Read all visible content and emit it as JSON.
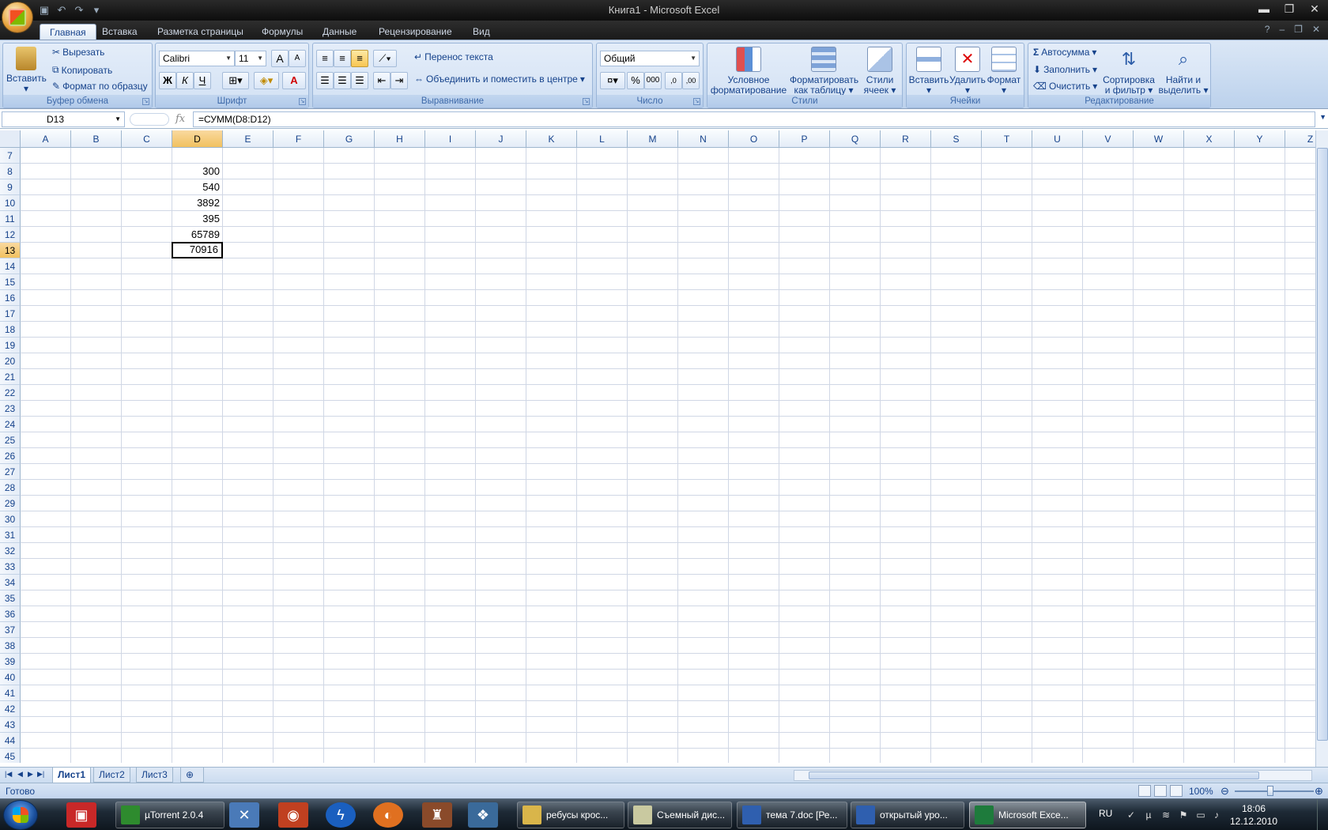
{
  "window": {
    "title": "Книга1 - Microsoft Excel",
    "minimize": "▬",
    "restore": "❐",
    "close": "✕"
  },
  "ribbon_tabs": [
    "Главная",
    "Вставка",
    "Разметка страницы",
    "Формулы",
    "Данные",
    "Рецензирование",
    "Вид"
  ],
  "clipboard": {
    "paste": "Вставить",
    "cut": "Вырезать",
    "copy": "Копировать",
    "format_painter": "Формат по образцу",
    "title": "Буфер обмена"
  },
  "font": {
    "name": "Calibri",
    "size": "11",
    "bold": "Ж",
    "italic": "К",
    "underline": "Ч",
    "grow": "A",
    "shrink": "A",
    "color_letter": "A",
    "title": "Шрифт"
  },
  "alignment": {
    "wrap_text": "Перенос текста",
    "merge_center": "Объединить и поместить в центре",
    "title": "Выравнивание"
  },
  "number": {
    "format": "Общий",
    "percent": "%",
    "thousands": "000",
    "inc_decimal": ",0",
    "dec_decimal": ",00",
    "title": "Число"
  },
  "styles": {
    "conditional": "Условное форматирование",
    "as_table": "Форматировать как таблицу",
    "cell_styles": "Стили ячеек",
    "title": "Стили"
  },
  "cells": {
    "insert": "Вставить",
    "delete": "Удалить",
    "format": "Формат",
    "title": "Ячейки"
  },
  "editing": {
    "autosum": "Автосумма",
    "fill": "Заполнить",
    "clear": "Очистить",
    "sort_filter": "Сортировка и фильтр",
    "find_select": "Найти и выделить",
    "title": "Редактирование"
  },
  "formula_bar": {
    "name_box": "D13",
    "fx": "fx",
    "formula": "=СУММ(D8:D12)"
  },
  "grid": {
    "columns": [
      "A",
      "B",
      "C",
      "D",
      "E",
      "F",
      "G",
      "H",
      "I",
      "J",
      "K",
      "L",
      "M",
      "N",
      "O",
      "P",
      "Q",
      "R",
      "S",
      "T",
      "U",
      "V",
      "W",
      "X",
      "Y",
      "Z"
    ],
    "selected_column": "D",
    "rows": [
      "7",
      "8",
      "9",
      "10",
      "11",
      "12",
      "13",
      "14",
      "15",
      "16",
      "17",
      "18",
      "19",
      "20",
      "21",
      "22",
      "23",
      "24",
      "25",
      "26",
      "27",
      "28",
      "29",
      "30",
      "31",
      "32",
      "33",
      "34",
      "35",
      "36",
      "37",
      "38",
      "39",
      "40",
      "41",
      "42",
      "43",
      "44",
      "45"
    ],
    "selected_row": "13",
    "cells": [
      {
        "ref": "D8",
        "value": "300"
      },
      {
        "ref": "D9",
        "value": "540"
      },
      {
        "ref": "D10",
        "value": "3892"
      },
      {
        "ref": "D11",
        "value": "395"
      },
      {
        "ref": "D12",
        "value": "65789"
      },
      {
        "ref": "D13",
        "value": "70916"
      }
    ]
  },
  "sheets": [
    "Лист1",
    "Лист2",
    "Лист3"
  ],
  "active_sheet": "Лист1",
  "status": {
    "text": "Готово",
    "zoom": "100%"
  },
  "taskbar": {
    "tasks": [
      {
        "label": "µTorrent 2.0.4",
        "color": "#2e8b2e"
      },
      {
        "label": "ребусы  крос...",
        "color": "#d9b54a"
      },
      {
        "label": "Съемный дис...",
        "color": "#c9c9a0"
      },
      {
        "label": "тема 7.doc [Ре...",
        "color": "#2f5faf"
      },
      {
        "label": "открытый уро...",
        "color": "#2f5faf"
      },
      {
        "label": "Microsoft Exce...",
        "color": "#1e7b3c"
      }
    ],
    "lang": "RU",
    "time": "18:06",
    "date": "12.12.2010"
  }
}
